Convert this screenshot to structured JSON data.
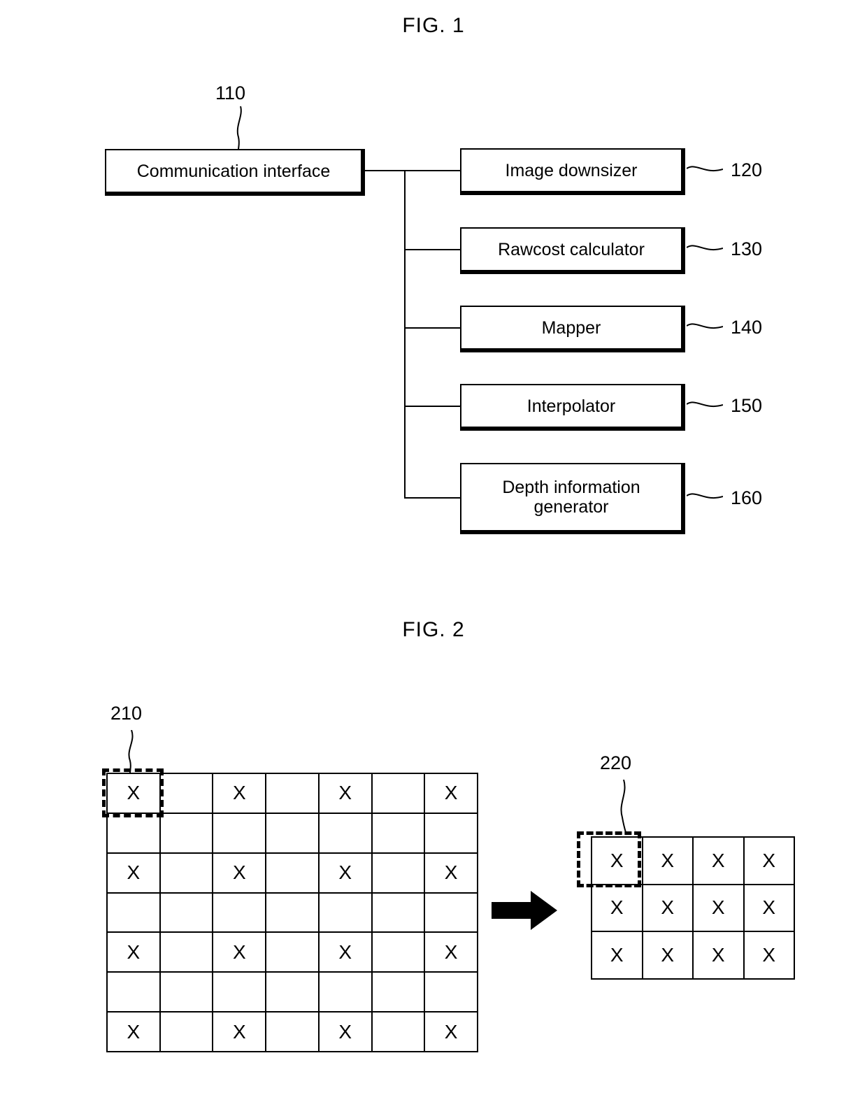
{
  "figures": [
    {
      "id": "fig1",
      "title": "FIG. 1",
      "blocks": [
        {
          "label": "Communication interface",
          "ref": "110"
        },
        {
          "label": "Image downsizer",
          "ref": "120"
        },
        {
          "label": "Rawcost calculator",
          "ref": "130"
        },
        {
          "label": "Mapper",
          "ref": "140"
        },
        {
          "label": "Interpolator",
          "ref": "150"
        },
        {
          "label": "Depth information generator",
          "ref": "160"
        }
      ]
    },
    {
      "id": "fig2",
      "title": "FIG. 2",
      "source_grid": {
        "ref": "210",
        "columns": 7,
        "rows": 7,
        "mark": "X",
        "marked_cells": [
          [
            1,
            0,
            1,
            0,
            1,
            0,
            1
          ],
          [
            0,
            0,
            0,
            0,
            0,
            0,
            0
          ],
          [
            1,
            0,
            1,
            0,
            1,
            0,
            1
          ],
          [
            0,
            0,
            0,
            0,
            0,
            0,
            0
          ],
          [
            1,
            0,
            1,
            0,
            1,
            0,
            1
          ],
          [
            0,
            0,
            0,
            0,
            0,
            0,
            0
          ],
          [
            1,
            0,
            1,
            0,
            1,
            0,
            1
          ]
        ]
      },
      "result_grid": {
        "ref": "220",
        "columns": 4,
        "rows": 3,
        "mark": "X",
        "marked_cells": [
          [
            1,
            1,
            1,
            1
          ],
          [
            1,
            1,
            1,
            1
          ],
          [
            1,
            1,
            1,
            1
          ]
        ]
      },
      "arrow": "right-arrow"
    }
  ],
  "fig1": {
    "title": "FIG. 1",
    "comm_interface": {
      "label": "Communication interface",
      "ref": "110"
    },
    "modules": [
      {
        "label": "Image downsizer",
        "ref": "120"
      },
      {
        "label": "Rawcost calculator",
        "ref": "130"
      },
      {
        "label": "Mapper",
        "ref": "140"
      },
      {
        "label": "Interpolator",
        "ref": "150"
      },
      {
        "label": "Depth information generator",
        "ref": "160",
        "line1": "Depth information",
        "line2": "generator"
      }
    ]
  },
  "fig2": {
    "title": "FIG. 2",
    "source_ref": "210",
    "result_ref": "220",
    "mark": "X"
  },
  "colors": {
    "ink": "#000000",
    "paper": "#ffffff"
  }
}
